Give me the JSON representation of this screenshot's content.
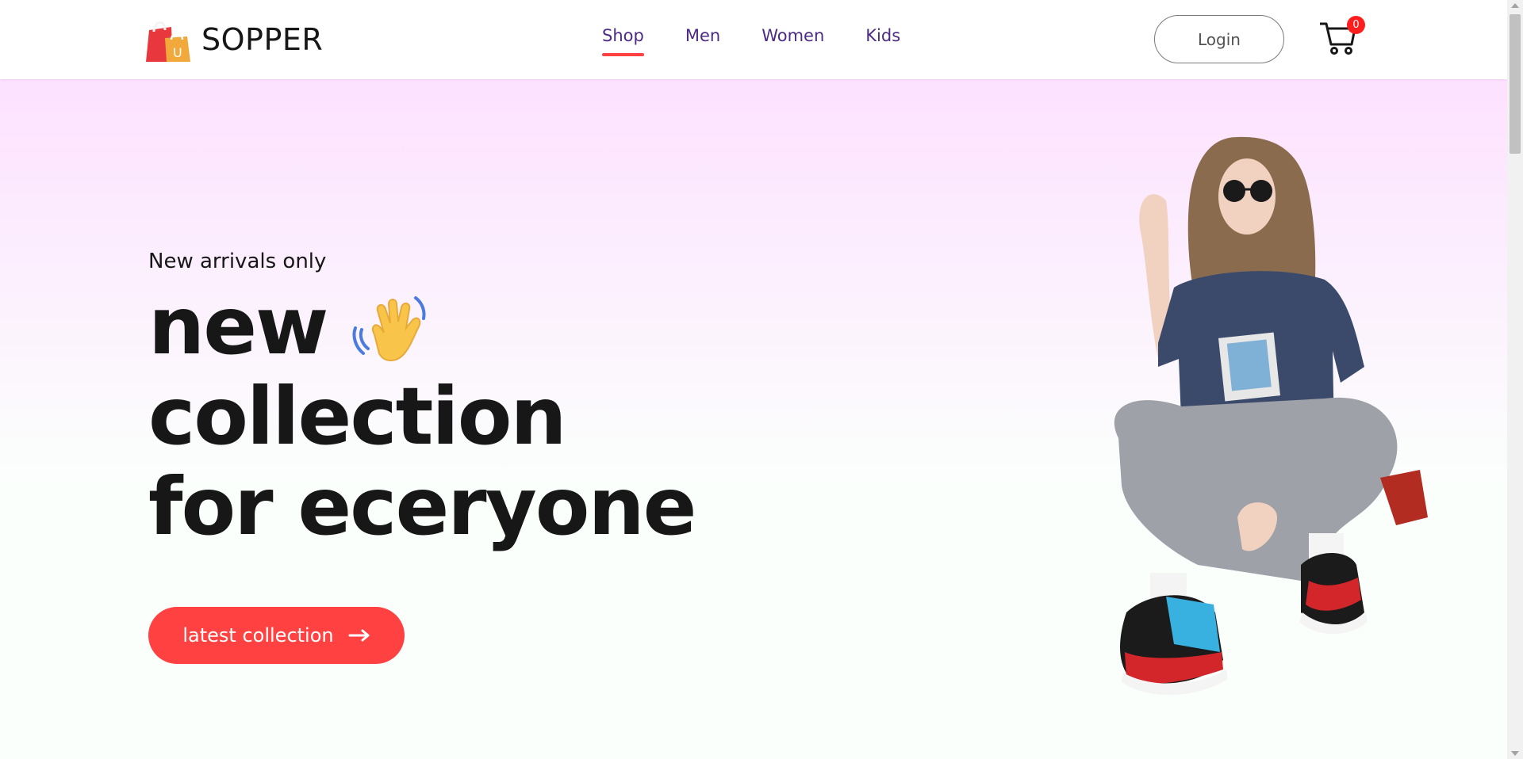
{
  "brand": {
    "name": "SOPPER",
    "logo_icon": "shopping-bag-icon",
    "logo_letter": "U"
  },
  "nav": {
    "items": [
      {
        "label": "Shop",
        "active": true
      },
      {
        "label": "Men",
        "active": false
      },
      {
        "label": "Women",
        "active": false
      },
      {
        "label": "Kids",
        "active": false
      }
    ]
  },
  "header": {
    "login_label": "Login",
    "cart_count": "0",
    "cart_icon": "cart-icon"
  },
  "hero": {
    "kicker": "New arrivals only",
    "line1": "new",
    "line2": "collection",
    "line3": "for eceryone",
    "wave_icon": "waving-hand-icon",
    "cta_label": "latest collection",
    "cta_icon": "arrow-right-icon",
    "image": "model-photo"
  },
  "colors": {
    "accent": "#ff4141",
    "nav_text": "#4c2a85",
    "hero_gradient_top": "#fde1ff",
    "text_dark": "#171717"
  }
}
